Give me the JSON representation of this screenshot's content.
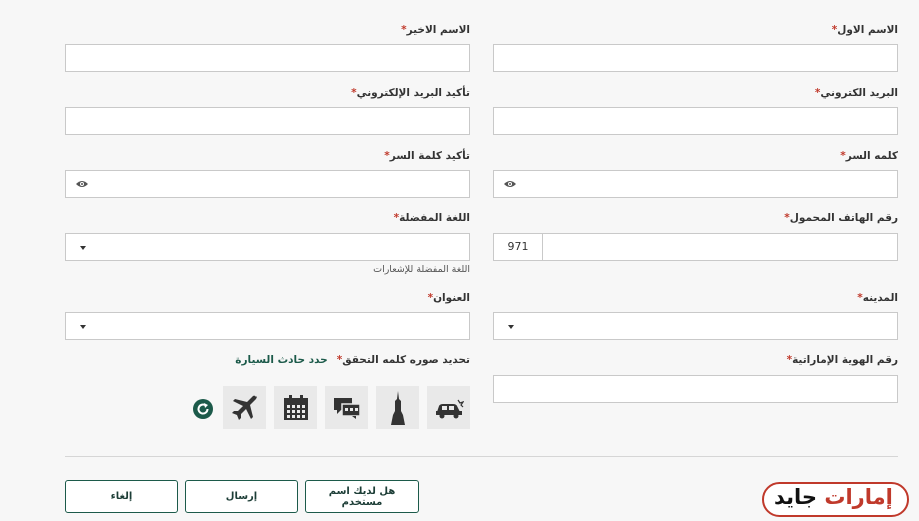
{
  "form": {
    "first_name": {
      "label": "الاسم الاول",
      "value": ""
    },
    "last_name": {
      "label": "الاسم الاخير",
      "value": ""
    },
    "email": {
      "label": "البريد الكتروني",
      "value": ""
    },
    "email_confirm": {
      "label": "تأكيد البريد الإلكتروني",
      "value": ""
    },
    "password": {
      "label": "كلمه السر",
      "value": ""
    },
    "password_confirm": {
      "label": "تأكيد كلمة السر",
      "value": ""
    },
    "mobile": {
      "label": "رقم الهاتف المحمول",
      "prefix": "971",
      "value": ""
    },
    "language": {
      "label": "اللغة المفضلة",
      "value": "",
      "hint": "اللغة المفضلة للإشعارات"
    },
    "city": {
      "label": "المدينه",
      "value": ""
    },
    "address": {
      "label": "العنوان",
      "value": ""
    },
    "emirates_id": {
      "label": "رقم الهوية الإماراتية",
      "value": ""
    },
    "required_mark": "*"
  },
  "captcha": {
    "label": "تحديد صوره كلمه التحقق",
    "instruction": "حدد حادث السيارة",
    "icons": [
      "car-crash-icon",
      "burj-tower-icon",
      "chat-bubbles-icon",
      "calendar-icon",
      "airplane-icon"
    ]
  },
  "buttons": {
    "have_username": "هل لديك اسم مستخدم",
    "submit": "إرسال",
    "cancel": "إلغاء"
  },
  "logo": {
    "part1": "إمارات",
    "part2": "جايد"
  },
  "colors": {
    "accent": "#1c5a4a",
    "required": "#c0392b",
    "logo_red": "#c0392b"
  }
}
